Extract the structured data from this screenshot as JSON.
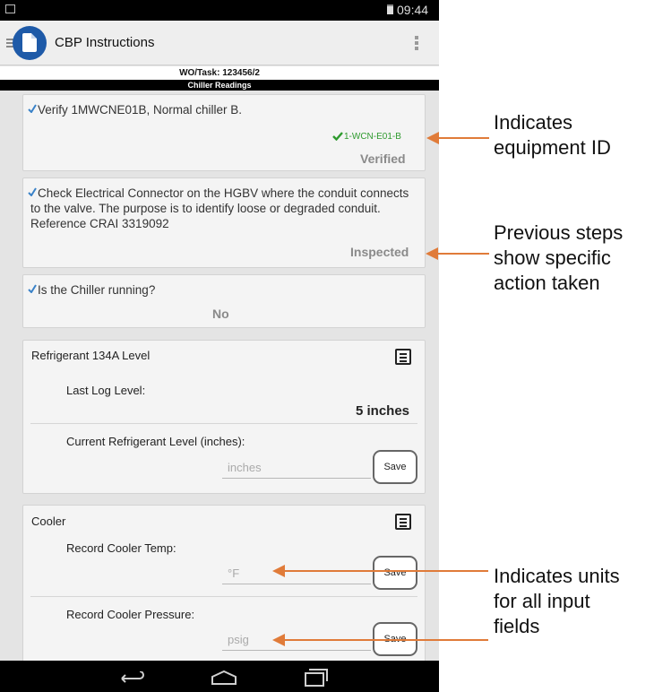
{
  "status_bar": {
    "time": "09:44"
  },
  "app": {
    "title": "CBP Instructions"
  },
  "work_order": {
    "label": "WO/Task: 123456/2"
  },
  "section": {
    "title": "Chiller Readings"
  },
  "steps": [
    {
      "text": "Verify 1MWCNE01B, Normal chiller B.",
      "equipment_id": "1-WCN-E01-B",
      "status": "Verified"
    },
    {
      "text": "Check Electrical Connector on the HGBV where the conduit connects to the valve. The purpose is to identify loose or degraded conduit. Reference CRAI 3319092",
      "status": "Inspected"
    },
    {
      "text": "Is the Chiller running?",
      "status": "No"
    }
  ],
  "refrigerant_card": {
    "title": "Refrigerant 134A Level",
    "last_log_label": "Last Log Level:",
    "last_log_value": "5 inches",
    "current_label": "Current Refrigerant Level (inches):",
    "current_placeholder": "inches",
    "save_label": "Save"
  },
  "cooler_card": {
    "title": "Cooler",
    "temp_label": "Record Cooler Temp:",
    "temp_placeholder": "°F",
    "pressure_label": "Record Cooler Pressure:",
    "pressure_placeholder": "psig",
    "save_label": "Save"
  },
  "annotations": {
    "equipment_id_line1": "Indicates",
    "equipment_id_line2": "equipment ID",
    "previous_steps_line1": "Previous steps",
    "previous_steps_line2": "show specific",
    "previous_steps_line3": "action taken",
    "units_line1": "Indicates units",
    "units_line2": "for all input",
    "units_line3": "fields"
  },
  "colors": {
    "accent_green": "#2e9a2e",
    "annotation_orange": "#e07b39",
    "logo_blue": "#1e5aa8"
  }
}
